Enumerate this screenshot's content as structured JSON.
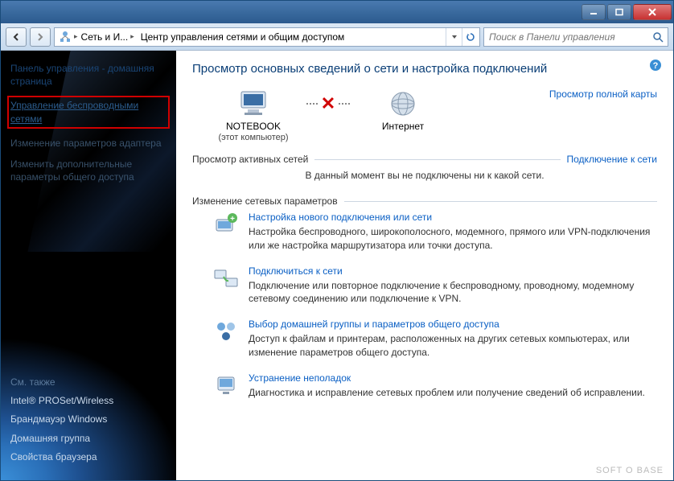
{
  "breadcrumb": {
    "seg1": "Сеть и И...",
    "seg2": "Центр управления сетями и общим доступом"
  },
  "search": {
    "placeholder": "Поиск в Панели управления"
  },
  "sidebar": {
    "home": "Панель управления - домашняя страница",
    "items": [
      {
        "label": "Управление беспроводными сетями"
      },
      {
        "label": "Изменение параметров адаптера"
      },
      {
        "label": "Изменить дополнительные параметры общего доступа"
      }
    ],
    "seeAlsoTitle": "См. также",
    "seeAlso": [
      {
        "label": "Intel® PROSet/Wireless"
      },
      {
        "label": "Брандмауэр Windows"
      },
      {
        "label": "Домашняя группа"
      },
      {
        "label": "Свойства браузера"
      }
    ]
  },
  "main": {
    "title": "Просмотр основных сведений о сети и настройка подключений",
    "mapLink": "Просмотр полной карты",
    "node1": "NOTEBOOK",
    "node1sub": "(этот компьютер)",
    "node2": "Интернет",
    "activeTitle": "Просмотр активных сетей",
    "connectLink": "Подключение к сети",
    "noNetwork": "В данный момент вы не подключены ни к какой сети.",
    "changeTitle": "Изменение сетевых параметров",
    "tasks": [
      {
        "title": "Настройка нового подключения или сети",
        "desc": "Настройка беспроводного, широкополосного, модемного, прямого или VPN-подключения или же настройка маршрутизатора или точки доступа."
      },
      {
        "title": "Подключиться к сети",
        "desc": "Подключение или повторное подключение к беспроводному, проводному, модемному сетевому соединению или подключение к VPN."
      },
      {
        "title": "Выбор домашней группы и параметров общего доступа",
        "desc": "Доступ к файлам и принтерам, расположенных на других сетевых компьютерах, или изменение параметров общего доступа."
      },
      {
        "title": "Устранение неполадок",
        "desc": "Диагностика и исправление сетевых проблем или получение сведений об исправлении."
      }
    ]
  },
  "watermark": "SOFT O BASE"
}
